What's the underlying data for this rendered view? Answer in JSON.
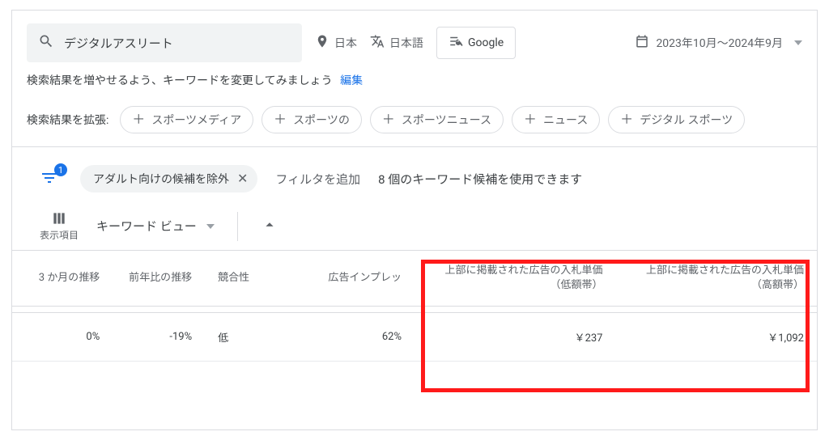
{
  "search": {
    "query": "デジタルアスリート"
  },
  "location": {
    "label": "日本"
  },
  "language": {
    "label": "日本語"
  },
  "network": {
    "label": "Google"
  },
  "date": {
    "label": "2023年10月～2024年9月"
  },
  "hint": {
    "text": "検索結果を増やせるよう、キーワードを変更してみましょう",
    "edit": "編集"
  },
  "expand": {
    "label": "検索結果を拡張:",
    "chips": [
      "スポーツメディア",
      "スポーツの",
      "スポーツニュース",
      "ニュース",
      "デジタル スポーツ"
    ]
  },
  "filter": {
    "badge": "1",
    "active_pill": "アダルト向けの候補を除外",
    "add_label": "フィルタを追加",
    "summary": "8 個のキーワード候補を使用できます"
  },
  "view": {
    "columns_label": "表示項目",
    "keyword_view_label": "キーワード ビュー"
  },
  "table": {
    "headers": {
      "c1": "3 か月の推移",
      "c2": "前年比の推移",
      "c3": "競合性",
      "c4": "広告インプレッ",
      "c5a": "上部に掲載された広告の入札単価",
      "c5b": "（低額帯）",
      "c6a": "上部に掲載された広告の入札単価",
      "c6b": "（高額帯）"
    },
    "row1": {
      "c1": "0%",
      "c2": "-19%",
      "c3": "低",
      "c4": "62%",
      "c5": "￥237",
      "c6": "￥1,092"
    }
  }
}
